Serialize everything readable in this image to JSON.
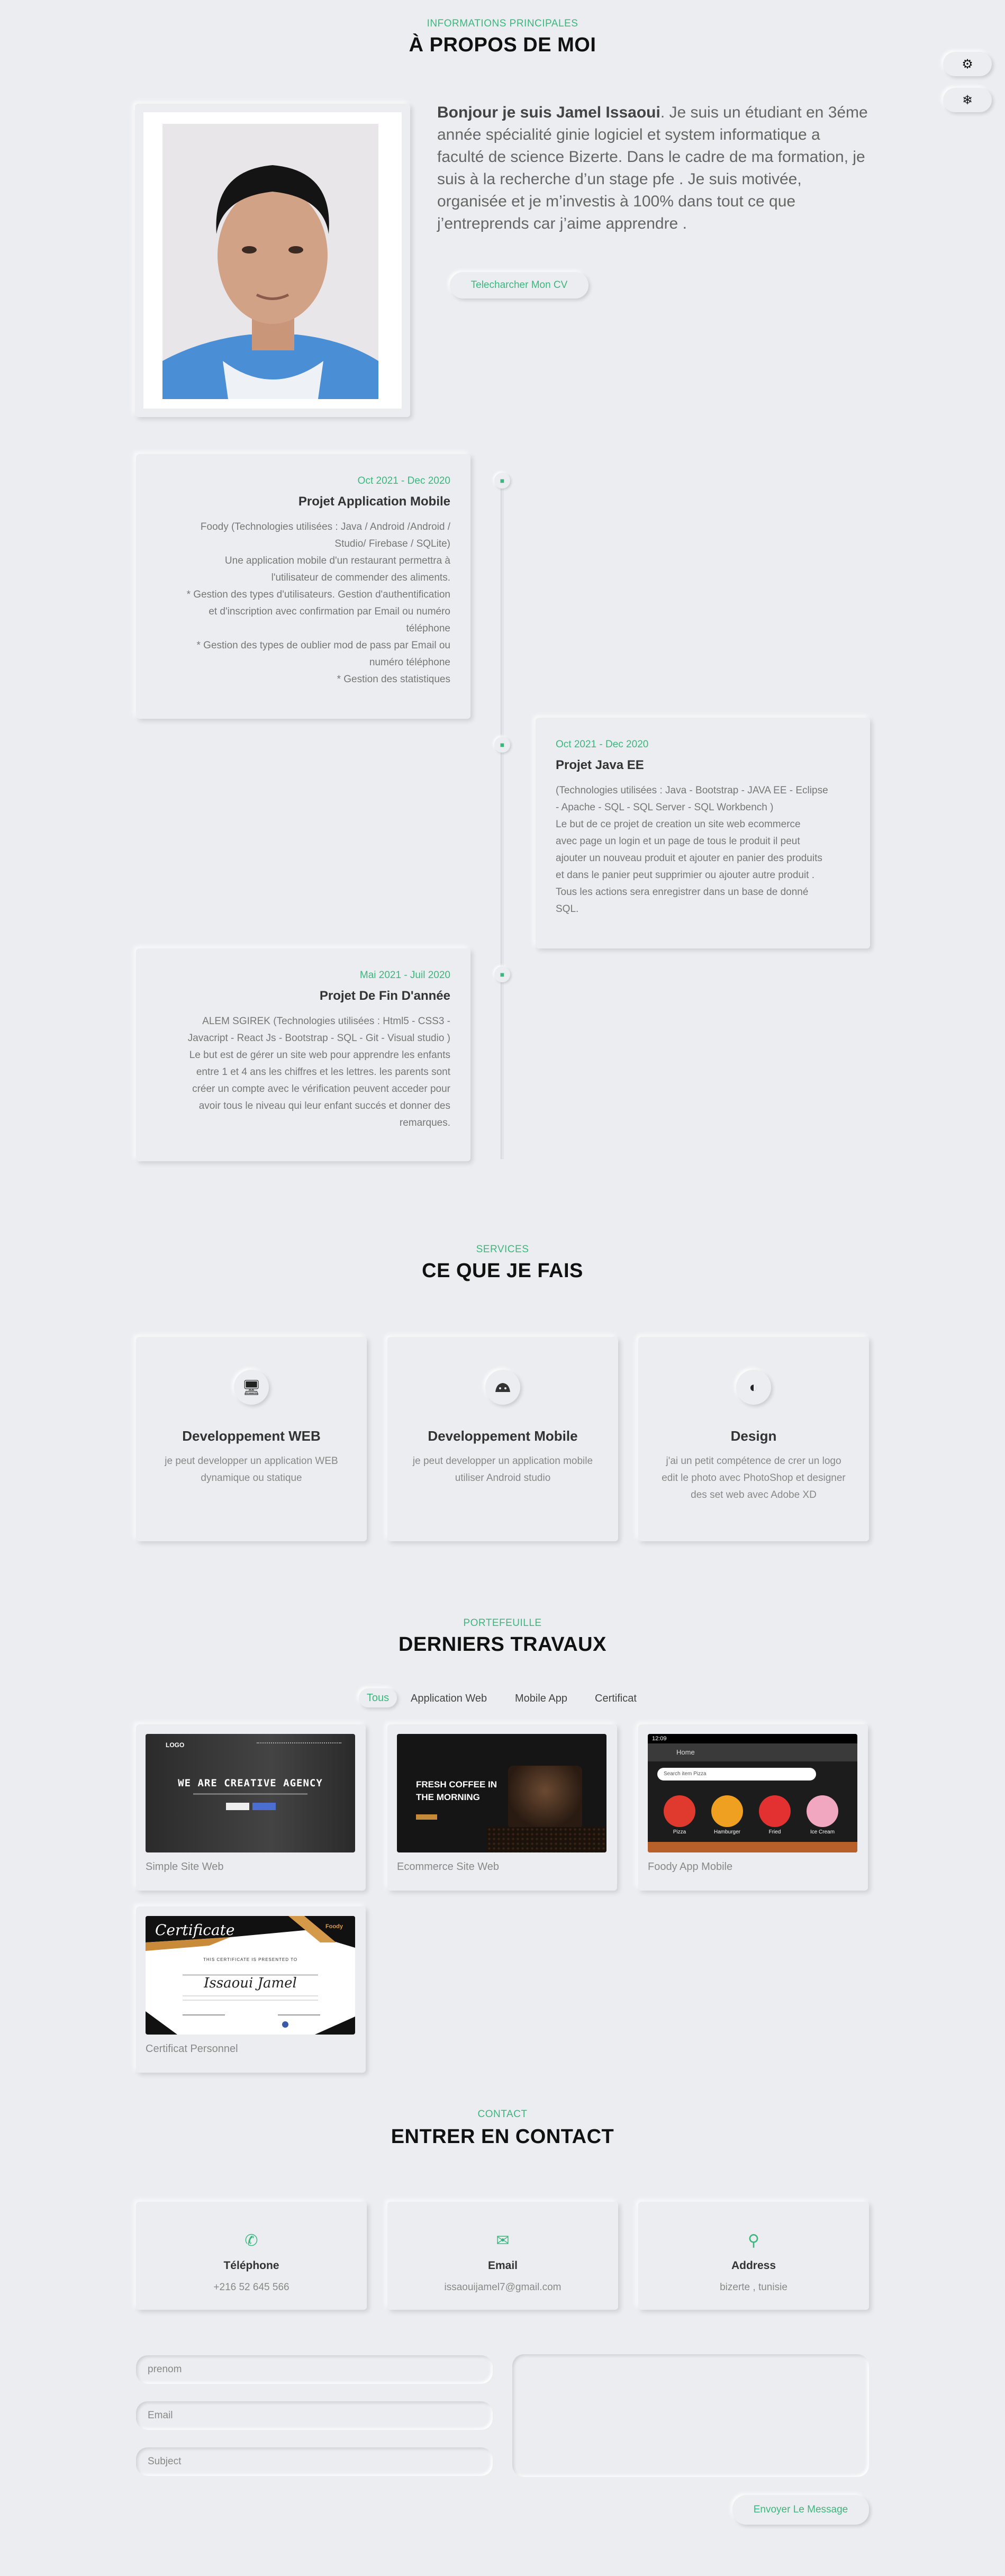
{
  "about": {
    "kicker": "INFORMATIONS PRINCIPALES",
    "title": "À PROPOS DE MOI",
    "greeting": "Bonjour je suis Jamel Issaoui",
    "bio": ". Je suis un étudiant en 3éme année spécialité ginie logiciel et system informatique a faculté de science Bizerte. Dans le cadre de ma formation, je suis à la recherche d’un stage pfe . Je suis motivée, organisée et je m’investis à 100% dans tout ce que j’entreprends car j’aime apprendre .",
    "cv_button": "Telecharcher Mon CV"
  },
  "timeline": [
    {
      "date": "Oct 2021 - Dec 2020",
      "name": "Projet Application Mobile",
      "lines": [
        "Foody (Technologies utilisées : Java / Android /Android /",
        "Studio/ Firebase / SQLite)",
        "Une application mobile d'un restaurant permettra à",
        "l'utilisateur de commender des aliments.",
        "* Gestion des types d'utilisateurs. Gestion d'authentification",
        "et d'inscription avec confirmation par Email ou numéro",
        "téléphone",
        "* Gestion des types de oublier mod de pass par Email ou",
        "numéro téléphone",
        "* Gestion des statistiques"
      ]
    },
    {
      "date": "Oct 2021 - Dec 2020",
      "name": "Projet Java EE",
      "lines": [
        "(Technologies utilisées : Java - Bootstrap - JAVA EE - Eclipse",
        "- Apache - SQL - SQL Server - SQL Workbench )",
        "Le but de ce projet de creation un site web ecommerce",
        "avec page un login et un page de tous le produit il peut",
        "ajouter un nouveau produit et ajouter en panier des produits",
        "et dans le panier peut supprimier ou ajouter autre produit .",
        "Tous les actions sera enregistrer dans un base de donné",
        "SQL."
      ]
    },
    {
      "date": "Mai 2021 - Juil 2020",
      "name": "Projet De Fin D'année",
      "lines": [
        "ALEM SGIREK (Technologies utilisées : Html5 - CSS3 -",
        "Javacript - React Js - Bootstrap - SQL - Git - Visual studio )",
        "Le but est de gérer un site web pour apprendre les enfants",
        "entre 1 et 4 ans les chiffres et les lettres. les parents sont",
        "créer un compte avec le vérification peuvent acceder pour",
        "avoir tous le niveau qui leur enfant succés et donner des",
        "remarques."
      ]
    }
  ],
  "services": {
    "kicker": "SERVICES",
    "title": "CE QUE JE FAIS",
    "items": [
      {
        "icon": "monitor-icon",
        "title": "Developpement WEB",
        "lines": [
          "je peut developper un application WEB",
          "dynamique ou statique"
        ]
      },
      {
        "icon": "android-icon",
        "title": "Developpement Mobile",
        "lines": [
          "je peut developper un application mobile",
          "utiliser Android studio"
        ]
      },
      {
        "icon": "contrast-icon",
        "title": "Design",
        "lines": [
          "j'ai un petit compétence de crer un logo",
          "edit le photo avec PhotoShop et designer",
          "des set web avec Adobe XD"
        ]
      }
    ]
  },
  "portfolio": {
    "kicker": "PORTEFEUILLE",
    "title": "DERNIERS TRAVAUX",
    "filters": [
      "Tous",
      "Application Web",
      "Mobile App",
      "Certificat"
    ],
    "items": [
      {
        "caption": "Simple Site Web",
        "logo": "LOGO",
        "headline": "WE ARE CREATIVE AGENCY"
      },
      {
        "caption": "Ecommerce Site Web",
        "headline1": "FRESH COFFEE IN",
        "headline2": "THE MORNING"
      },
      {
        "caption": "Foody App Mobile",
        "time": "12:09",
        "bar": "Home",
        "search": "Search item Pizza",
        "foods": [
          "Pizza",
          "Hamburger",
          "Fried",
          "Ice Cream"
        ]
      },
      {
        "caption": "Certificat Personnel",
        "cert_title": "Certificate",
        "cert_sub": "THIS CERTIFICATE IS PRESENTED TO",
        "cert_name": "Issaoui Jamel",
        "brand": "Foody"
      }
    ]
  },
  "contact": {
    "kicker": "CONTACT",
    "title": "ENTRER EN CONTACT",
    "cards": [
      {
        "icon": "phone-icon",
        "title": "Téléphone",
        "value": "+216 52 645 566"
      },
      {
        "icon": "envelope-icon",
        "title": "Email",
        "value": "issaouijamel7@gmail.com"
      },
      {
        "icon": "map-marker-icon",
        "title": "Address",
        "value": "bizerte , tunisie"
      }
    ],
    "placeholders": {
      "prenom": "prenom",
      "email": "Email",
      "subject": "Subject"
    },
    "send": "Envoyer Le Message"
  },
  "colors": {
    "accent": "#3bb77e",
    "background": "#ebedf1"
  }
}
